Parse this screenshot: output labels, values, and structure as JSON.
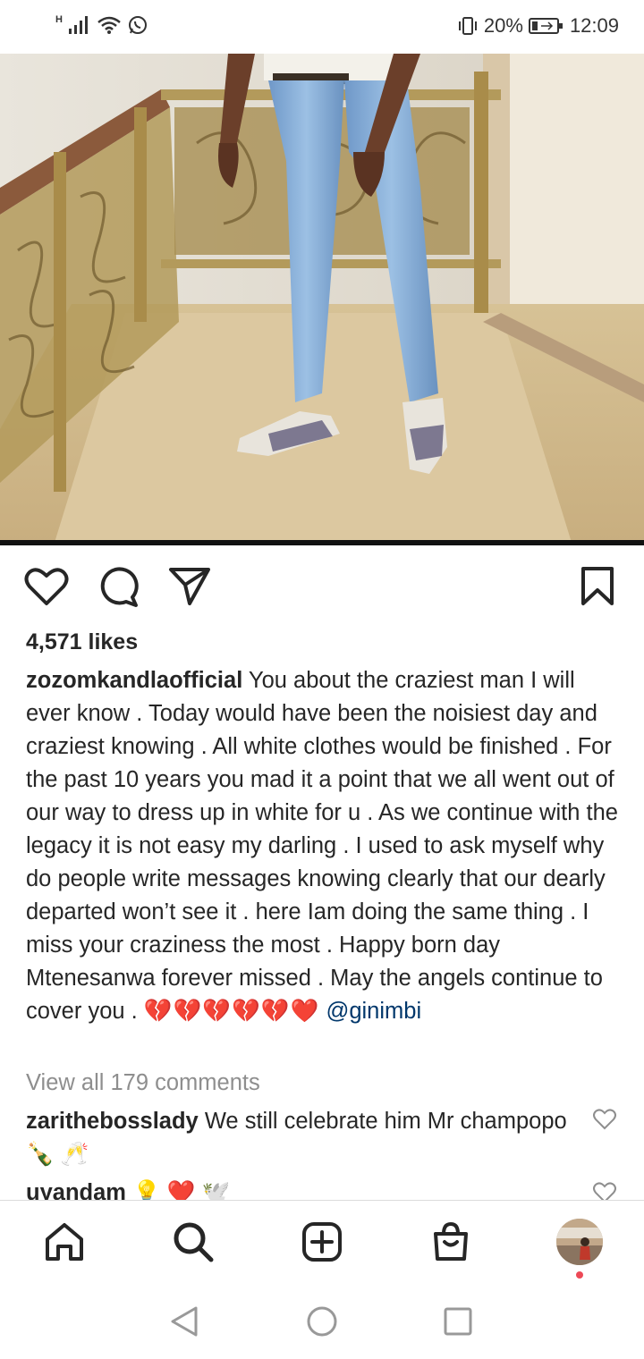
{
  "status_bar": {
    "network": "H",
    "battery": "20%",
    "time": "12:09"
  },
  "post": {
    "likes": "4,571 likes",
    "caption_user": "zozomkandlaofficial",
    "caption_text": "You about the craziest man I will ever know . Today would have been the noisiest day and craziest knowing . All white clothes would be finished . For the past 10 years you mad it a point that we all went out of our way to dress up in white for u . As we continue with the legacy it is not easy my darling . I used to ask myself why do people write messages knowing clearly that our dearly departed won’t see it . here Iam doing the same thing . I miss your craziness the most . Happy born day Mtenesanwa forever missed . May the angels continue to cover you .",
    "caption_emojis": "💔💔💔💔💔❤️",
    "mention": "@ginimbi",
    "view_all": "View all 179 comments"
  },
  "comments": [
    {
      "user": "zarithebosslady",
      "text": "We still celebrate him Mr champopo 🍾 🥂"
    },
    {
      "user": "uyandam",
      "text": "💡 ❤️ 🕊️"
    }
  ],
  "icons": {
    "like": "heart-outline-icon",
    "comment": "comment-bubble-icon",
    "share": "paper-plane-icon",
    "save": "bookmark-icon",
    "home": "home-icon",
    "search": "search-icon",
    "create": "plus-square-icon",
    "shop": "shopping-bag-icon"
  },
  "colors": {
    "text": "#262626",
    "muted": "#8e8e8e",
    "mention": "#00376b",
    "notification_dot": "#ed4956"
  }
}
